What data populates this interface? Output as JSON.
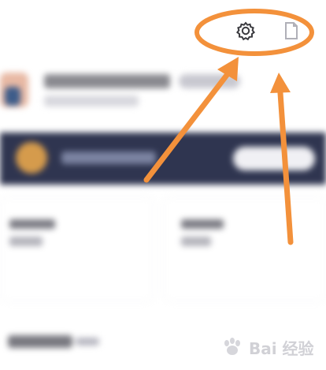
{
  "screen": {
    "background": "#ffffff",
    "accent_annotation_color": "#f3913b",
    "banner_color": "#2f3550"
  },
  "top_bar": {
    "settings_icon": "gear-icon",
    "messages_icon": "document-icon"
  },
  "watermark": {
    "text": "Bai 经验",
    "icon": "paw-icon"
  }
}
